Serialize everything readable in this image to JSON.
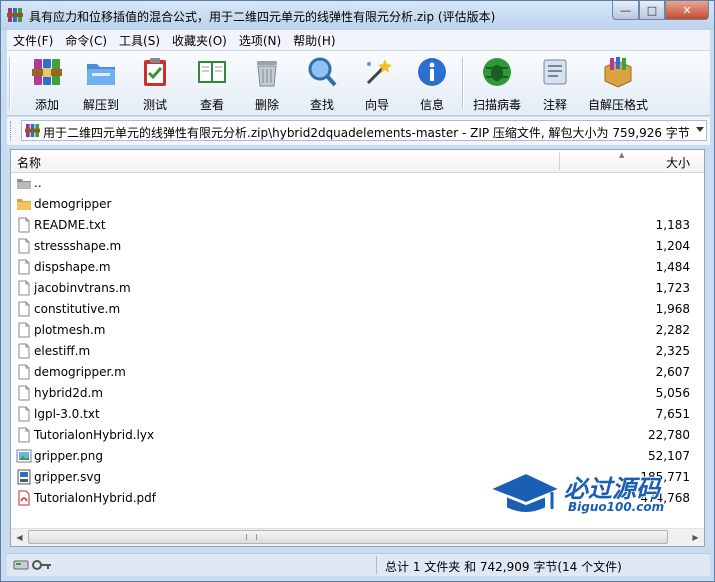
{
  "window": {
    "title": "具有应力和位移插值的混合公式，用于二维四元单元的线弹性有限元分析.zip (评估版本)",
    "controls": {
      "minimize": "—",
      "maximize": "□",
      "close": "✕"
    }
  },
  "menu": [
    "文件(F)",
    "命令(C)",
    "工具(S)",
    "收藏夹(O)",
    "选项(N)",
    "帮助(H)"
  ],
  "toolbar": [
    {
      "label": "添加",
      "icon": "add-archive-icon"
    },
    {
      "label": "解压到",
      "icon": "extract-folder-icon"
    },
    {
      "label": "测试",
      "icon": "test-clipboard-icon"
    },
    {
      "label": "查看",
      "icon": "view-book-icon"
    },
    {
      "label": "删除",
      "icon": "trash-icon"
    },
    {
      "label": "查找",
      "icon": "magnifier-icon"
    },
    {
      "label": "向导",
      "icon": "wizard-wand-icon"
    },
    {
      "label": "信息",
      "icon": "info-icon"
    },
    {
      "label": "扫描病毒",
      "icon": "virus-scan-icon"
    },
    {
      "label": "注释",
      "icon": "comment-icon"
    },
    {
      "label": "自解压格式",
      "icon": "sfx-box-icon"
    }
  ],
  "address": {
    "path": "用于二维四元单元的线弹性有限元分析.zip\\hybrid2dquadelements-master - ZIP 压缩文件, 解包大小为 759,926 字节"
  },
  "columns": {
    "name": "名称",
    "size": "大小"
  },
  "files": [
    {
      "name": "..",
      "size": "",
      "type": "up"
    },
    {
      "name": "demogripper",
      "size": "",
      "type": "folder"
    },
    {
      "name": "README.txt",
      "size": "1,183",
      "type": "text"
    },
    {
      "name": "stressshape.m",
      "size": "1,204",
      "type": "text"
    },
    {
      "name": "dispshape.m",
      "size": "1,484",
      "type": "text"
    },
    {
      "name": "jacobinvtrans.m",
      "size": "1,723",
      "type": "text"
    },
    {
      "name": "constitutive.m",
      "size": "1,968",
      "type": "text"
    },
    {
      "name": "plotmesh.m",
      "size": "2,282",
      "type": "text"
    },
    {
      "name": "elestiff.m",
      "size": "2,325",
      "type": "text"
    },
    {
      "name": "demogripper.m",
      "size": "2,607",
      "type": "text"
    },
    {
      "name": "hybrid2d.m",
      "size": "5,056",
      "type": "text"
    },
    {
      "name": "lgpl-3.0.txt",
      "size": "7,651",
      "type": "text"
    },
    {
      "name": "TutorialonHybrid.lyx",
      "size": "22,780",
      "type": "text"
    },
    {
      "name": "gripper.png",
      "size": "52,107",
      "type": "image"
    },
    {
      "name": "gripper.svg",
      "size": "185,771",
      "type": "svg"
    },
    {
      "name": "TutorialonHybrid.pdf",
      "size": "474,768",
      "type": "pdf"
    }
  ],
  "watermark": {
    "title": "必过源码",
    "url": "Biguo100.com"
  },
  "status": {
    "summary": "总计 1 文件夹 和 742,909 字节(14 个文件)"
  },
  "colors": {
    "accent": "#1a5fb4",
    "window_frame": "#c9dbef"
  }
}
